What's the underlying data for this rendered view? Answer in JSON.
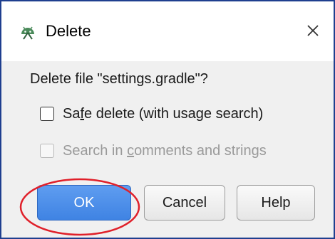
{
  "dialog": {
    "title": "Delete",
    "app_icon": "android-studio-icon",
    "close_icon": "close-icon"
  },
  "message": {
    "question": "Delete file \"settings.gradle\"?"
  },
  "options": {
    "safe_delete": {
      "label_pre": "Sa",
      "label_mnemonic": "f",
      "label_post": "e delete (with usage search)",
      "checked": false,
      "enabled": true
    },
    "search_comments": {
      "label_pre": "Search in ",
      "label_mnemonic": "c",
      "label_post": "omments and strings",
      "checked": false,
      "enabled": false
    }
  },
  "buttons": {
    "ok_label": "OK",
    "cancel_label": "Cancel",
    "help_label": "Help"
  },
  "annotation": {
    "highlight_color": "#e0202a",
    "highlighted": "ok-button"
  },
  "colors": {
    "primary_button": "#4a8de8",
    "title_bar": "#ffffff",
    "dialog_bg": "#f0f0f0",
    "frame_border": "#1f3f8f",
    "icon_green": "#4a8a5a"
  }
}
